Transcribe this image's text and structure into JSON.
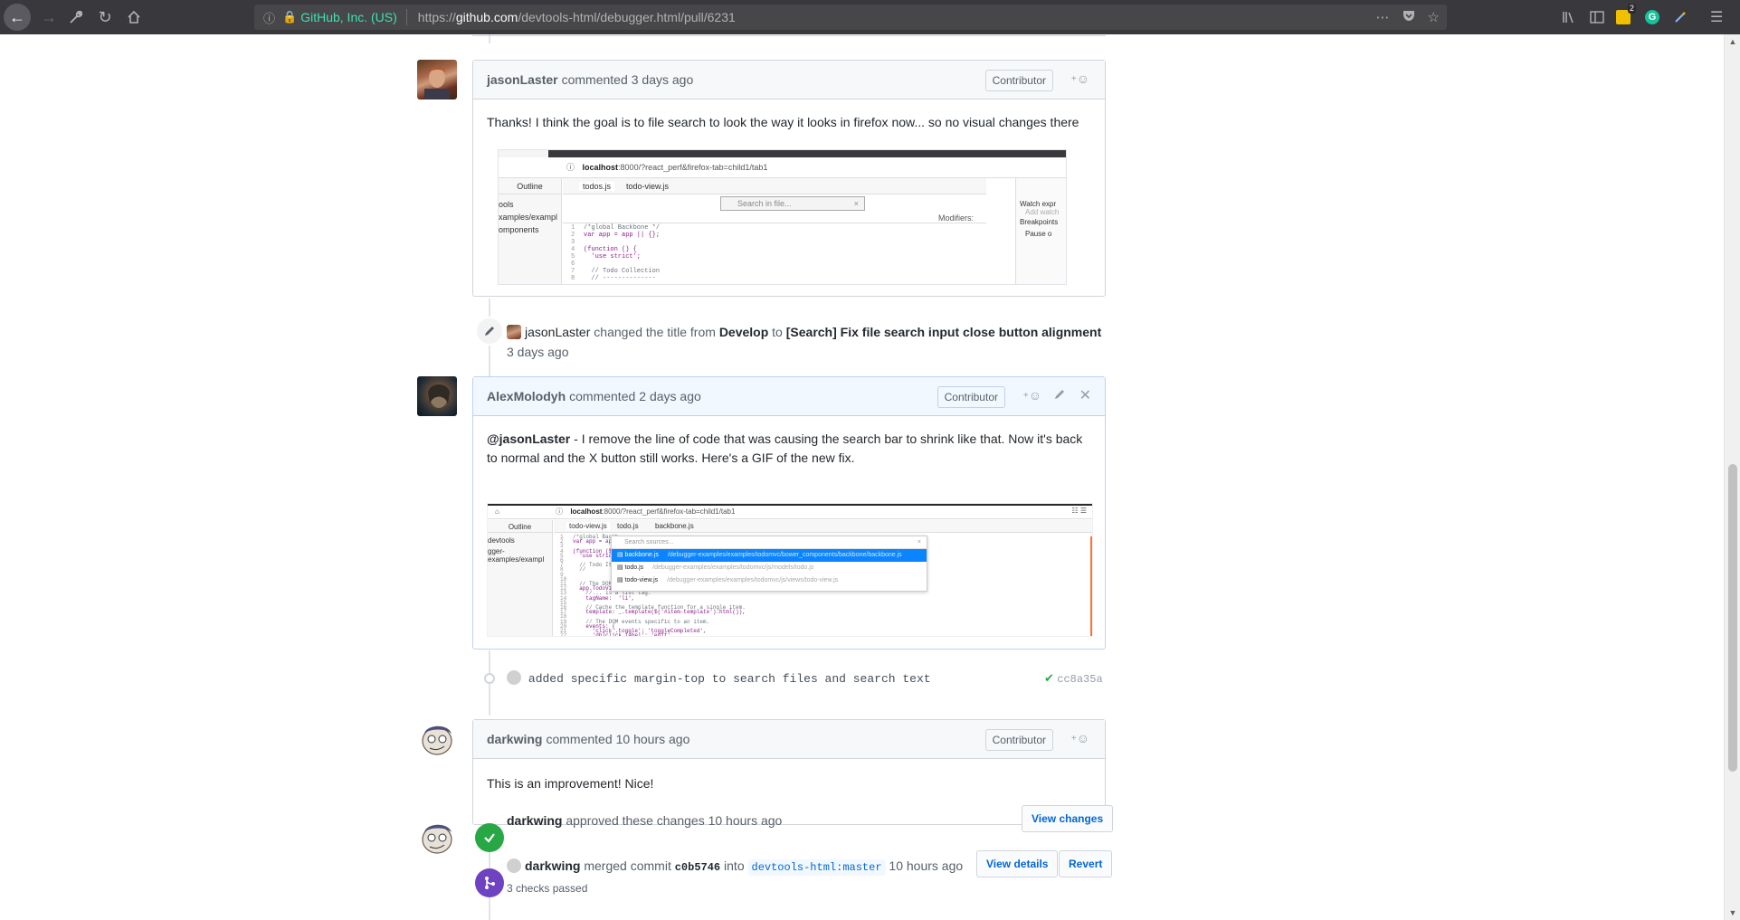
{
  "browser": {
    "url_org": "GitHub, Inc. (US)",
    "url_prefix": "https://",
    "url_host": "github.com",
    "url_path": "/devtools-html/debugger.html/pull/6231",
    "notification_count": "2"
  },
  "timeline": {
    "comment1": {
      "author": "jasonLaster",
      "verb": "commented",
      "time": "3 days ago",
      "badge": "Contributor",
      "body": "Thanks! I think the goal is to file search to look the way it looks in firefox now... so no visual changes there",
      "shot": {
        "url_host": "localhost",
        "url_path": ":8000/?react_perf&firefox-tab=child1/tab1",
        "outline": "Outline",
        "tab1": "todos.js",
        "tab2": "todo-view.js",
        "search_placeholder": "Search in file...",
        "modifiers": "Modifiers:",
        "watch": "Watch expr",
        "add_watch": "Add watch",
        "breakpoints": "Breakpoints",
        "pause": "Pause o",
        "tree": [
          "ools",
          "xamples/exampl",
          "omponents"
        ],
        "code": [
          "/*global Backbone */",
          "var app = app || {};",
          "",
          "(function () {",
          "  'use strict';",
          "",
          "  // Todo Collection",
          "  // --------------"
        ]
      }
    },
    "rename": {
      "author": "jasonLaster",
      "text1": "changed the title from",
      "old_title": "Develop",
      "text2": "to",
      "new_title": "[Search] Fix file search input close button alignment",
      "time": "3 days ago"
    },
    "comment2": {
      "author": "AlexMolodyh",
      "verb": "commented",
      "time": "2 days ago",
      "badge": "Contributor",
      "mention": "@jasonLaster",
      "body": " - I remove the line of code that was causing the search bar to shrink like that. Now it's back to normal and the X button still works. Here's a GIF of the new fix.",
      "shot": {
        "url_host": "localhost",
        "url_path": ":8000/?react_perf&firefox-tab=child1/tab1",
        "outline": "Outline",
        "tab1": "todo-view.js",
        "tab2": "todo.js",
        "tab3": "backbone.js",
        "search_placeholder": "Search sources...",
        "results": [
          {
            "name": "backbone.js",
            "path": "/debugger-examples/examples/todomvc/bower_components/backbone/backbone.js"
          },
          {
            "name": "todo.js",
            "path": "/debugger-examples/examples/todomvc/js/models/todo.js"
          },
          {
            "name": "todo-view.js",
            "path": "/debugger-examples/examples/todomvc/js/views/todo-view.js"
          }
        ],
        "tree": [
          "devtools",
          "gger-examples/exampl"
        ],
        "code": [
          "/*global Backb",
          "var app = app",
          "",
          "(function ($) {",
          "  'use strict",
          "",
          "  // Todo It",
          "  //",
          "",
          "",
          "  // The DOM element for a todo item...",
          "  app.TodoView = Backbone.View.extend({",
          "    //... is a list tag.",
          "    tagName:  'li',",
          "",
          "    // Cache the template function for a single item.",
          "    template: _.template($('#item-template').html()),",
          "",
          "    // The DOM events specific to an item.",
          "    events: {",
          "      'click .toggle': 'toggleCompleted',",
          "      'dblclick label': 'edit',",
          "      'click .destroy': 'clear',"
        ]
      }
    },
    "commit": {
      "message": "added specific margin-top to search files and search text",
      "sha": "cc8a35a"
    },
    "comment3": {
      "author": "darkwing",
      "verb": "commented",
      "time": "10 hours ago",
      "badge": "Contributor",
      "body": "This is an improvement! Nice!"
    },
    "review": {
      "author": "darkwing",
      "text": "approved these changes",
      "time": "10 hours ago",
      "button": "View changes"
    },
    "merge": {
      "author": "darkwing",
      "text1": "merged commit",
      "commit": "c0b5746",
      "text2": "into",
      "branch": "devtools-html:master",
      "time": "10 hours ago",
      "details_button": "View details",
      "revert_button": "Revert",
      "checks": "3 checks passed"
    }
  }
}
